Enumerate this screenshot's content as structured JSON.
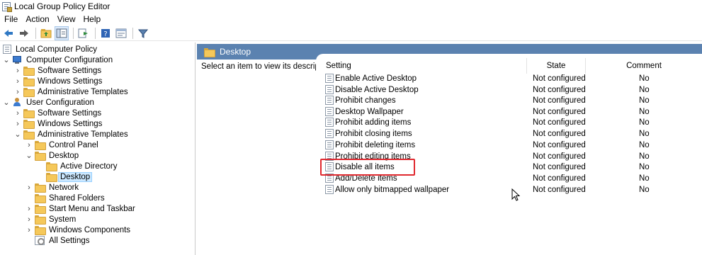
{
  "window": {
    "title": "Local Group Policy Editor"
  },
  "menu": [
    {
      "label": "File",
      "name": "menu-file"
    },
    {
      "label": "Action",
      "name": "menu-action"
    },
    {
      "label": "View",
      "name": "menu-view"
    },
    {
      "label": "Help",
      "name": "menu-help"
    }
  ],
  "toolbar": {
    "buttons": [
      "back-arrow-icon",
      "forward-arrow-icon",
      "up-folder-icon",
      "show-hide-tree-icon",
      "export-list-icon",
      "help-icon",
      "properties-icon",
      "filter-icon"
    ]
  },
  "tree": [
    {
      "label": "Local Computer Policy",
      "icon": "policy-icon",
      "expand": ""
    },
    {
      "label": "Computer Configuration",
      "icon": "computer-icon",
      "expand": "expanded"
    },
    {
      "label": "Software Settings",
      "icon": "folder-icon",
      "expand": "collapsed"
    },
    {
      "label": "Windows Settings",
      "icon": "folder-icon",
      "expand": "collapsed"
    },
    {
      "label": "Administrative Templates",
      "icon": "folder-icon",
      "expand": "collapsed"
    },
    {
      "label": "User Configuration",
      "icon": "user-icon",
      "expand": "expanded"
    },
    {
      "label": "Software Settings",
      "icon": "folder-icon",
      "expand": "collapsed"
    },
    {
      "label": "Windows Settings",
      "icon": "folder-icon",
      "expand": "collapsed"
    },
    {
      "label": "Administrative Templates",
      "icon": "folder-icon",
      "expand": "expanded"
    },
    {
      "label": "Control Panel",
      "icon": "folder-icon",
      "expand": "collapsed"
    },
    {
      "label": "Desktop",
      "icon": "folder-icon",
      "expand": "expanded"
    },
    {
      "label": "Active Directory",
      "icon": "folder-icon",
      "expand": ""
    },
    {
      "label": "Desktop",
      "icon": "folder-icon",
      "expand": "",
      "selected": true
    },
    {
      "label": "Network",
      "icon": "folder-icon",
      "expand": "collapsed"
    },
    {
      "label": "Shared Folders",
      "icon": "folder-icon",
      "expand": ""
    },
    {
      "label": "Start Menu and Taskbar",
      "icon": "folder-icon",
      "expand": "collapsed"
    },
    {
      "label": "System",
      "icon": "folder-icon",
      "expand": "collapsed"
    },
    {
      "label": "Windows Components",
      "icon": "folder-icon",
      "expand": "collapsed"
    },
    {
      "label": "All Settings",
      "icon": "settings-icon",
      "expand": ""
    }
  ],
  "details": {
    "header_title": "Desktop",
    "description": "Select an item to view its description.",
    "columns": {
      "setting": "Setting",
      "state": "State",
      "comment": "Comment"
    },
    "rows": [
      {
        "setting": "Enable Active Desktop",
        "state": "Not configured",
        "comment": "No"
      },
      {
        "setting": "Disable Active Desktop",
        "state": "Not configured",
        "comment": "No"
      },
      {
        "setting": "Prohibit changes",
        "state": "Not configured",
        "comment": "No"
      },
      {
        "setting": "Desktop Wallpaper",
        "state": "Not configured",
        "comment": "No"
      },
      {
        "setting": "Prohibit adding items",
        "state": "Not configured",
        "comment": "No"
      },
      {
        "setting": "Prohibit closing items",
        "state": "Not configured",
        "comment": "No"
      },
      {
        "setting": "Prohibit deleting items",
        "state": "Not configured",
        "comment": "No"
      },
      {
        "setting": "Prohibit editing items",
        "state": "Not configured",
        "comment": "No"
      },
      {
        "setting": "Disable all items",
        "state": "Not configured",
        "comment": "No",
        "highlighted": true
      },
      {
        "setting": "Add/Delete items",
        "state": "Not configured",
        "comment": "No"
      },
      {
        "setting": "Allow only bitmapped wallpaper",
        "state": "Not configured",
        "comment": "No"
      }
    ]
  },
  "colors": {
    "header_bar": "#5b82b0",
    "selection": "#cce8ff",
    "highlight_border": "#e0282e",
    "folder": "#f5c85a"
  }
}
